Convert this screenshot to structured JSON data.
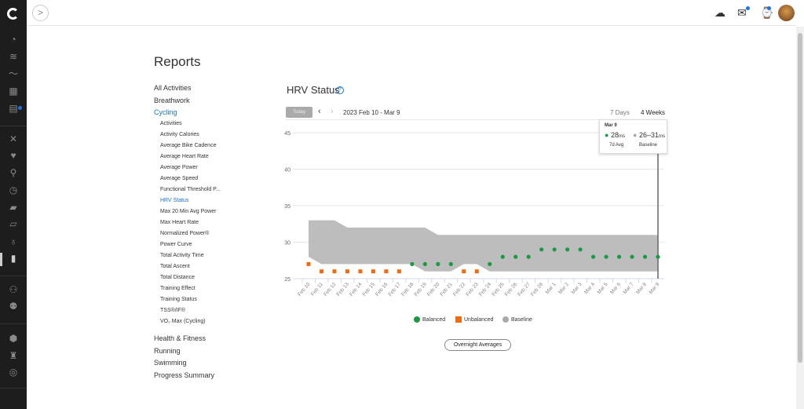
{
  "nav": {
    "icons": [
      "dashboard-icon",
      "layers-icon",
      "trend-icon",
      "calendar-icon",
      "news-icon",
      "fitness-icon",
      "heart-icon",
      "golf-icon",
      "stopwatch-icon",
      "shoe-icon",
      "sneaker-icon",
      "bulb-icon",
      "reports-icon",
      "connections-icon",
      "groups-icon",
      "badges-icon",
      "trophy-icon",
      "settings-icon"
    ]
  },
  "page": {
    "title": "Reports"
  },
  "menu": {
    "top": [
      "All Activities",
      "Breathwork",
      "Cycling"
    ],
    "cycling": [
      "Activities",
      "Activity Calories",
      "Average Bike Cadence",
      "Average Heart Rate",
      "Average Power",
      "Average Speed",
      "Functional Threshold P...",
      "HRV Status",
      "Max 20 Min Avg Power",
      "Max Heart Rate",
      "Normalized Power®",
      "Power Curve",
      "Total Activity Time",
      "Total Ascent",
      "Total Distance",
      "Training Effect",
      "Training Status",
      "TSS®/IF®",
      "VO₂ Max (Cycling)"
    ],
    "bottom": [
      "Health & Fitness",
      "Running",
      "Swimming",
      "Progress Summary"
    ]
  },
  "report": {
    "title": "HRV Status",
    "help": "?",
    "today": "Today",
    "range": "2023 Feb 10 - Mar 9",
    "period_7": "7 Days",
    "period_4w": "4 Weeks",
    "overnight": "Overnight Averages"
  },
  "tooltip": {
    "date": "Mar 9",
    "avg": "28",
    "avg_unit": "ms",
    "avg_label": "7d Avg",
    "baseline": "26–31",
    "baseline_unit": "ms",
    "baseline_label": "Baseline"
  },
  "colors": {
    "balanced": "#1a9a41",
    "unbalanced": "#f06a0f",
    "baseline": "#bdbdbd",
    "accent": "#1a73c8"
  },
  "chart_data": {
    "type": "scatter",
    "title": "HRV Status",
    "ylim": [
      25,
      45
    ],
    "yticks": [
      25,
      30,
      35,
      40,
      45
    ],
    "categories": [
      "Feb 10",
      "Feb 11",
      "Feb 12",
      "Feb 13",
      "Feb 14",
      "Feb 15",
      "Feb 16",
      "Feb 17",
      "Feb 18",
      "Feb 19",
      "Feb 20",
      "Feb 21",
      "Feb 22",
      "Feb 23",
      "Feb 24",
      "Feb 25",
      "Feb 26",
      "Feb 27",
      "Feb 28",
      "Mar 1",
      "Mar 2",
      "Mar 3",
      "Mar 4",
      "Mar 5",
      "Mar 6",
      "Mar 7",
      "Mar 8",
      "Mar 9"
    ],
    "values": [
      27,
      26,
      26,
      26,
      26,
      26,
      26,
      26,
      27,
      27,
      27,
      27,
      26,
      26,
      27,
      28,
      28,
      28,
      29,
      29,
      29,
      29,
      28,
      28,
      28,
      28,
      28,
      28
    ],
    "status": [
      "U",
      "U",
      "U",
      "U",
      "U",
      "U",
      "U",
      "U",
      "B",
      "B",
      "B",
      "B",
      "U",
      "U",
      "B",
      "B",
      "B",
      "B",
      "B",
      "B",
      "B",
      "B",
      "B",
      "B",
      "B",
      "B",
      "B",
      "B"
    ],
    "baseline_low": [
      28,
      27,
      27,
      27,
      27,
      27,
      27,
      27,
      27,
      26,
      26,
      26,
      27,
      27,
      26,
      26,
      26,
      26,
      26,
      26,
      26,
      26,
      26,
      26,
      26,
      26,
      26,
      26
    ],
    "baseline_high": [
      33,
      33,
      33,
      32,
      32,
      32,
      32,
      32,
      32,
      32,
      31,
      31,
      31,
      31,
      31,
      31,
      31,
      31,
      31,
      31,
      31,
      31,
      31,
      31,
      31,
      31,
      31,
      31
    ],
    "legend": [
      "Balanced",
      "Unbalanced",
      "Baseline"
    ],
    "legend_position": "bottom",
    "grid": true
  }
}
